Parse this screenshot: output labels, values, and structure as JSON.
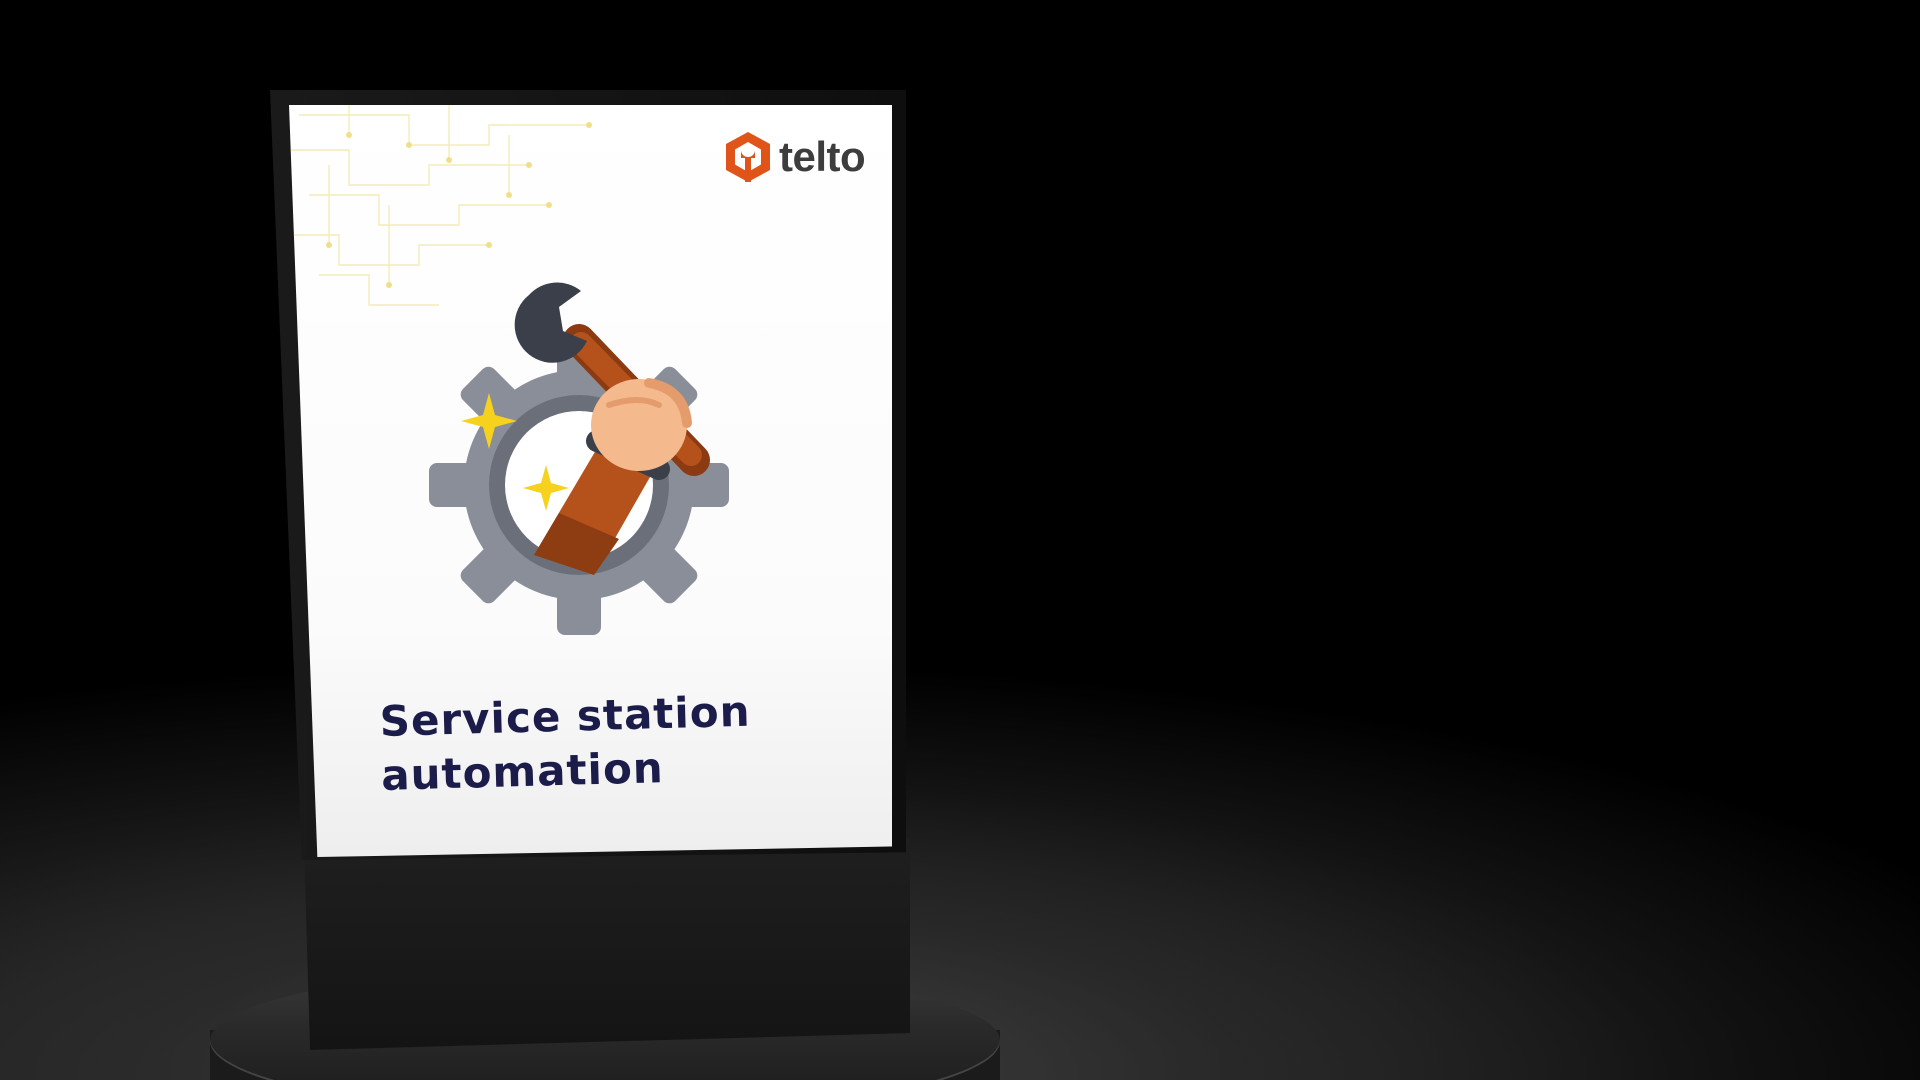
{
  "brand": {
    "name": "telto",
    "accent_color": "#e0541a",
    "text_color": "#3d3d3d"
  },
  "display": {
    "title_line1": "Service station",
    "title_line2": "automation",
    "title_color": "#1c1c4a",
    "illustration_icon": "hand-wrench-gear-icon"
  }
}
